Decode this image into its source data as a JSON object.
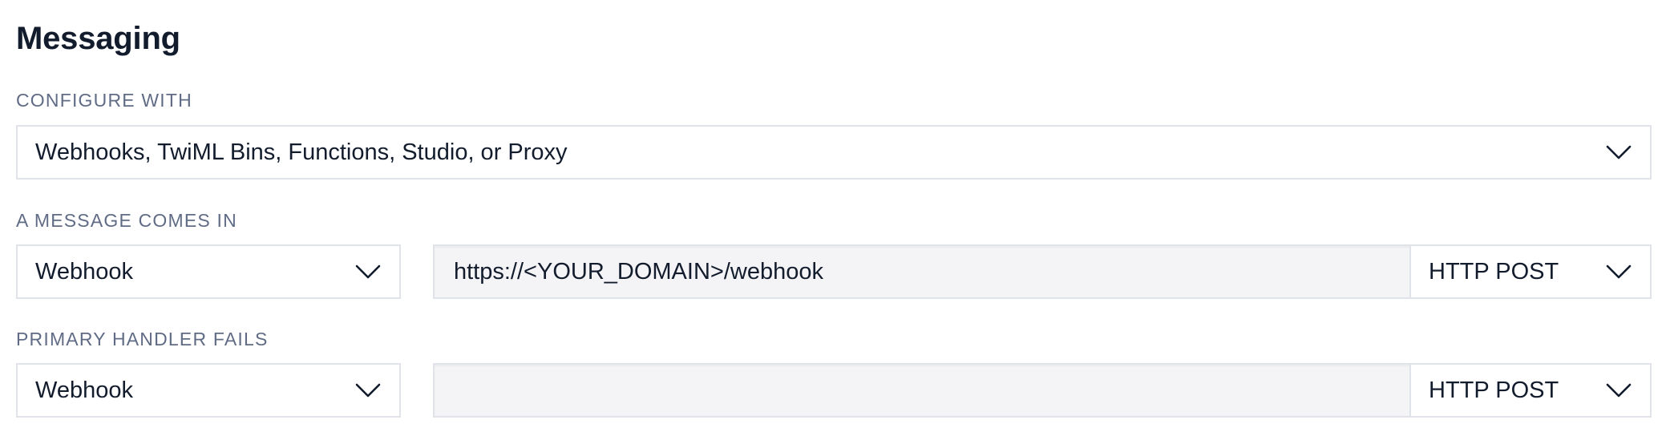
{
  "section": {
    "title": "Messaging"
  },
  "configure_with": {
    "label": "CONFIGURE WITH",
    "value": "Webhooks, TwiML Bins, Functions, Studio, or Proxy"
  },
  "message_comes_in": {
    "label": "A MESSAGE COMES IN",
    "handler_type": "Webhook",
    "url_value": "https://<YOUR_DOMAIN>/webhook",
    "method": "HTTP POST"
  },
  "primary_handler_fails": {
    "label": "PRIMARY HANDLER FAILS",
    "handler_type": "Webhook",
    "url_value": "",
    "method": "HTTP POST"
  },
  "icons": {
    "dropdown": "chevron-down-icon"
  },
  "colors": {
    "text": "#121c2d",
    "label": "#606b85",
    "border": "#e1e3ea",
    "input_bg": "#f4f4f6"
  }
}
